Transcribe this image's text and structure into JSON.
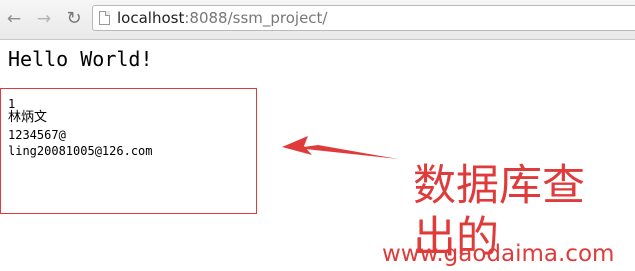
{
  "browser": {
    "url_host": "localhost",
    "url_rest": ":8088/ssm_project/",
    "icons": [
      "back-arrow-icon",
      "forward-arrow-icon",
      "reload-icon",
      "page-icon"
    ]
  },
  "page": {
    "heading": "Hello World!",
    "record": {
      "id": "1",
      "name": "林炳文",
      "password": "1234567@",
      "email": "ling20081005@126.com"
    }
  },
  "annotation": {
    "text": "数据库查出的",
    "color": "#e03b3b"
  },
  "watermark": "www.gaodaima.com"
}
